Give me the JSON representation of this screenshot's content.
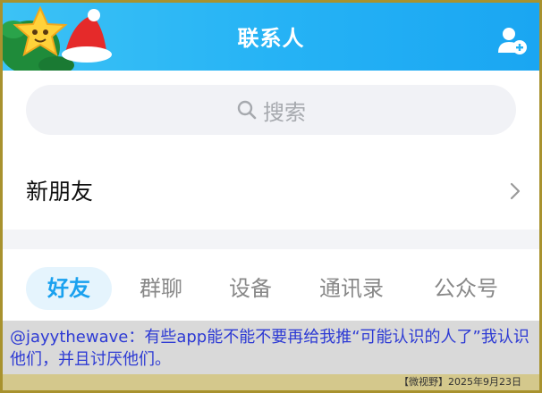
{
  "header": {
    "title": "联系人",
    "background": "#26b3f5",
    "decoration": [
      "star-icon",
      "santa-hat-icon"
    ],
    "right_icon": "add-contact-icon"
  },
  "search": {
    "icon": "search-icon",
    "placeholder": "搜索"
  },
  "new_friends": {
    "label": "新朋友",
    "icon": "chevron-right-icon"
  },
  "tabs": [
    {
      "label": "好友",
      "active": true
    },
    {
      "label": "群聊",
      "active": false
    },
    {
      "label": "设备",
      "active": false
    },
    {
      "label": "通讯录",
      "active": false
    },
    {
      "label": "公众号",
      "active": false
    }
  ],
  "caption": {
    "text": "@jayythewave：有些app能不能不要再给我推“可能认识的人了”我认识他们，并且讨厌他们。",
    "color": "#2d3ad4"
  },
  "footer": {
    "text": "【微视野】2025年9月23日"
  },
  "colors": {
    "accent": "#1aa1ef",
    "tab_active_bg": "#e5f4fd"
  }
}
